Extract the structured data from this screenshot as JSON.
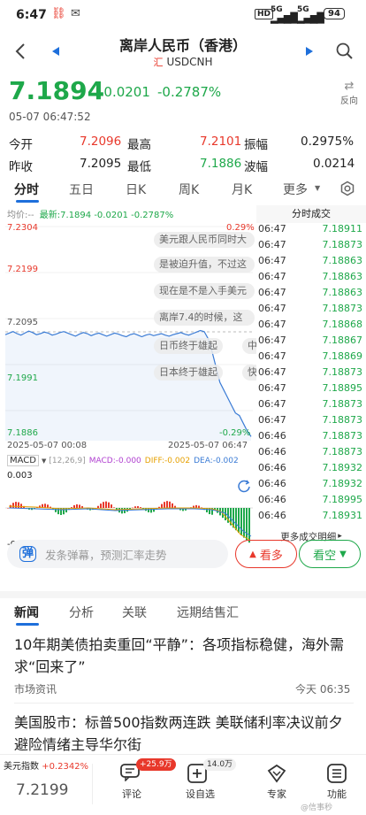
{
  "status_bar": {
    "time": "6:47",
    "signal1": "5G",
    "signal2": "5G",
    "battery": "94",
    "hd": "HD"
  },
  "nav": {
    "title": "离岸人民币（香港）",
    "code_badge": "汇",
    "code": "USDCNH"
  },
  "quote": {
    "price": "7.1894",
    "change": "-0.0201",
    "change_pct": "-0.2787%",
    "datetime": "05-07 06:47:52",
    "reverse_label": "反向"
  },
  "stats": [
    {
      "label": "今开",
      "value": "7.2096",
      "value_color": "#e8382b"
    },
    {
      "label": "最高",
      "value": "7.2101",
      "value_color": "#e8382b"
    },
    {
      "label": "振幅",
      "value": "0.2975%",
      "value_color": "#222"
    },
    {
      "label": "昨收",
      "value": "7.2095",
      "value_color": "#222"
    },
    {
      "label": "最低",
      "value": "7.1886",
      "value_color": "#1ea84a"
    },
    {
      "label": "波幅",
      "value": "0.0214",
      "value_color": "#222"
    }
  ],
  "tabs": [
    "分时",
    "五日",
    "日K",
    "周K",
    "月K",
    "更多"
  ],
  "chart": {
    "avg_label": "均价:--",
    "latest_label": "最新:7.1894",
    "change": "-0.0201",
    "change_pct": "-0.2787%",
    "y_labels": [
      "7.2304",
      "7.2199",
      "7.2095",
      "7.1991",
      "7.1886"
    ],
    "pct_top": "0.29%",
    "pct_bottom": "-0.29%",
    "time_start": "2025-05-07 00:08",
    "time_end": "2025-05-07 06:47",
    "macd_label": "MACD",
    "macd_params": "[12,26,9]",
    "macd_value": "MACD:-0.000",
    "diff_value": "DIFF:-0.002",
    "dea_value": "DEA:-0.002",
    "macd_top": "0.003",
    "macd_bottom": "-0.003",
    "bubbles": [
      "美元跟人民币同时大",
      "是被迫升值，不过这",
      "现在是不是入手美元",
      "离岸7.4的时候，这",
      "日币终于雄起",
      "中",
      "日本终于雄起",
      "快"
    ],
    "price_series": [
      7.2093,
      7.2096,
      7.2099,
      7.2095,
      7.2092,
      7.2096,
      7.21,
      7.2097,
      7.2093,
      7.2095,
      7.2098,
      7.2096,
      7.2092,
      7.2094,
      7.2097,
      7.2099,
      7.2096,
      7.2093,
      7.209,
      7.2094,
      7.2097,
      7.2095,
      7.2091,
      7.2094,
      7.2096,
      7.2093,
      7.209,
      7.2093,
      7.2096,
      7.2094,
      7.2091,
      7.2089,
      7.2093,
      7.2095,
      7.2092,
      7.2089,
      7.2092,
      7.2094,
      7.2091,
      7.2093,
      7.2095,
      7.2092,
      7.209,
      7.2093,
      7.2095,
      7.2097,
      7.2094,
      7.2092,
      7.2095,
      7.2098,
      7.2101,
      7.2099,
      7.2085,
      7.206,
      7.203,
      7.2,
      7.1985,
      7.197,
      7.1955,
      7.194,
      7.1935,
      7.192,
      7.1905,
      7.1894
    ]
  },
  "trades": {
    "title": "分时成交",
    "rows": [
      [
        "06:47",
        "7.18911"
      ],
      [
        "06:47",
        "7.18873"
      ],
      [
        "06:47",
        "7.18863"
      ],
      [
        "06:47",
        "7.18863"
      ],
      [
        "06:47",
        "7.18863"
      ],
      [
        "06:47",
        "7.18873"
      ],
      [
        "06:47",
        "7.18868"
      ],
      [
        "06:47",
        "7.18867"
      ],
      [
        "06:47",
        "7.18869"
      ],
      [
        "06:47",
        "7.18873"
      ],
      [
        "06:47",
        "7.18895"
      ],
      [
        "06:47",
        "7.18873"
      ],
      [
        "06:47",
        "7.18873"
      ],
      [
        "06:46",
        "7.18873"
      ],
      [
        "06:46",
        "7.18873"
      ],
      [
        "06:46",
        "7.18932"
      ],
      [
        "06:46",
        "7.18932"
      ],
      [
        "06:46",
        "7.18995"
      ],
      [
        "06:46",
        "7.18931"
      ]
    ],
    "more": "更多成交明细"
  },
  "danmu": {
    "placeholder": "发条弹幕，预测汇率走势",
    "bull": "看多",
    "bear": "看空"
  },
  "news_tabs": [
    "新闻",
    "分析",
    "关联",
    "远期结售汇"
  ],
  "news": [
    {
      "title": "10年期美债拍卖重回“平静”：各项指标稳健，海外需求“回来了”",
      "source": "市场资讯",
      "time": "今天 06:35"
    },
    {
      "title": "美国股市：标普500指数两连跌 美联储利率决议前夕避险情绪主导华尔街",
      "source": "",
      "time": ""
    }
  ],
  "bottom": {
    "index_label": "美元指数",
    "index_change": "+0.2342%",
    "index_value": "7.2199",
    "comment_badge": "+25.9万",
    "comment_label": "评论",
    "watch_badge": "14.0万",
    "watch_label": "设自选",
    "expert_label": "专家",
    "func_label": "功能",
    "watermark": "@信事秒"
  }
}
